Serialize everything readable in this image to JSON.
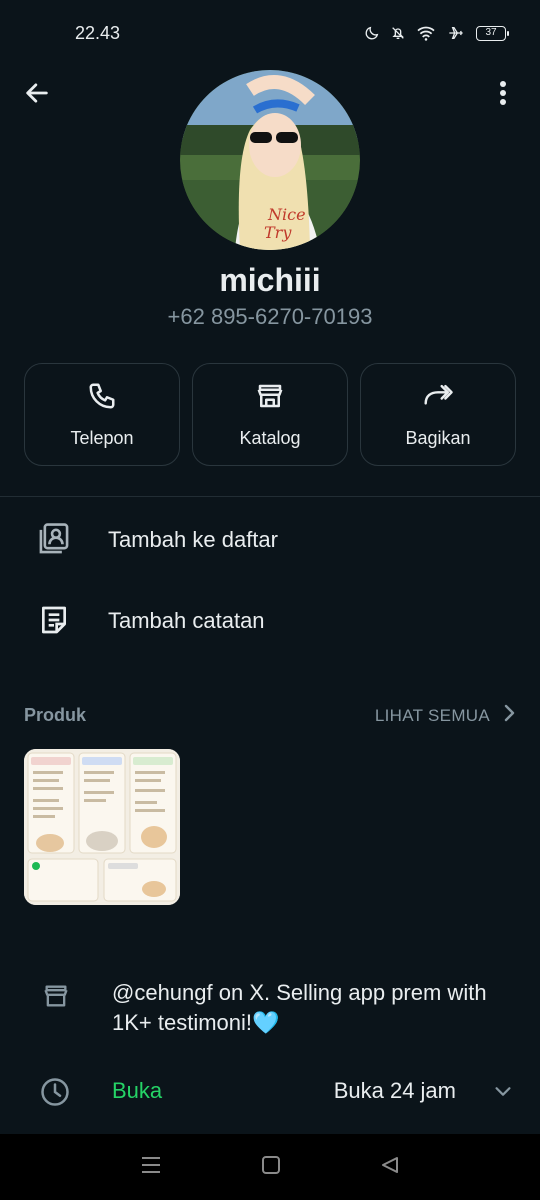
{
  "status_bar": {
    "time": "22.43",
    "battery": "37",
    "icons": [
      "moon-icon",
      "bell-off-icon",
      "wifi-icon",
      "airplane-icon",
      "battery-icon"
    ]
  },
  "profile": {
    "name": "michiii",
    "phone": "+62 895-6270-70193"
  },
  "actions": [
    {
      "label": "Telepon",
      "icon": "phone-icon"
    },
    {
      "label": "Katalog",
      "icon": "store-icon"
    },
    {
      "label": "Bagikan",
      "icon": "share-icon"
    }
  ],
  "menu": [
    {
      "label": "Tambah ke daftar",
      "icon": "contact-list-icon"
    },
    {
      "label": "Tambah catatan",
      "icon": "note-icon"
    }
  ],
  "products": {
    "title": "Produk",
    "see_all": "LIHAT SEMUA"
  },
  "business": {
    "description": "@cehungf on X. Selling app prem with 1K+ testimoni!🩵",
    "hours_status": "Buka",
    "hours_value": "Buka 24 jam"
  },
  "colors": {
    "background": "#0b141a",
    "accent_green": "#25d366",
    "secondary_text": "#8696a0"
  }
}
